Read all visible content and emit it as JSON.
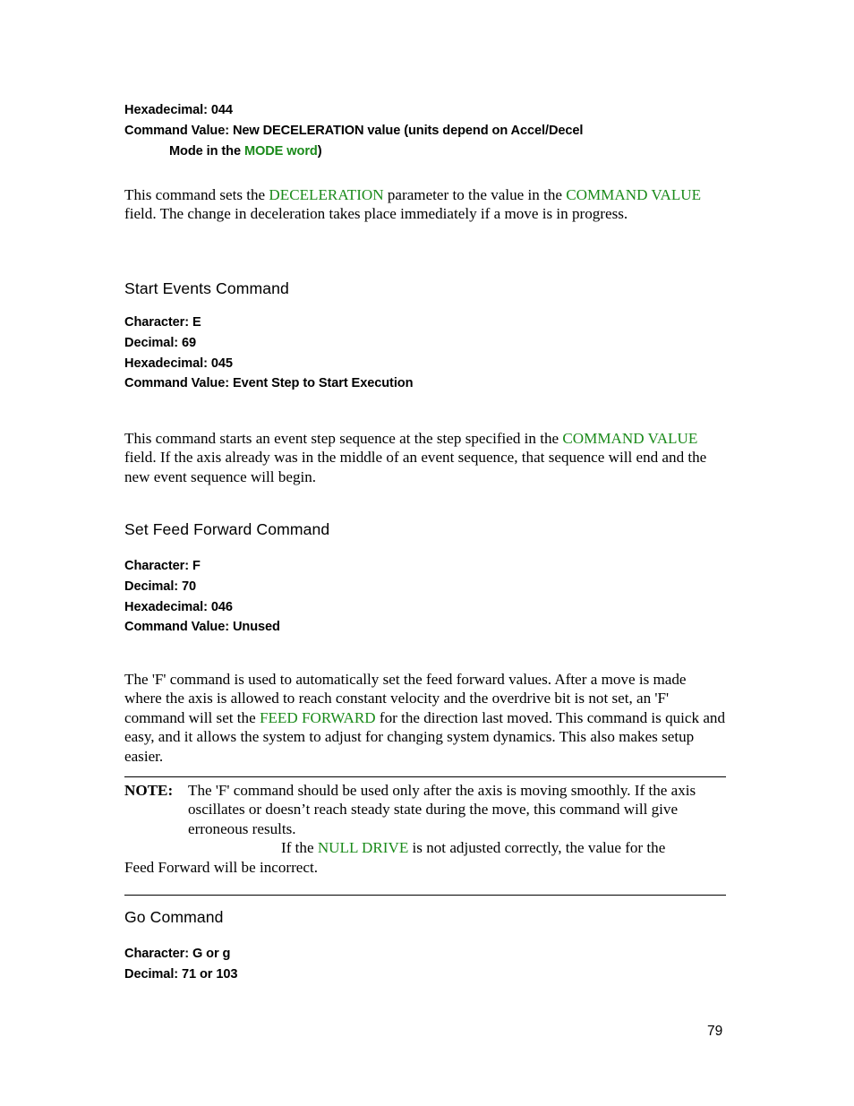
{
  "document": {
    "page_number": "79",
    "accent_green": "#1a8a1a"
  },
  "decel_section": {
    "hexadecimal_line": "Hexadecimal: 044",
    "command_value_line": "Command Value: New DECELERATION value (units depend on Accel/Decel",
    "command_value_cont_pre": "Mode in the ",
    "command_value_cont_green": "MODE word",
    "command_value_cont_post": ")",
    "paragraph": {
      "p1": "This command sets the ",
      "g1": "DECELERATION",
      "p2": " parameter to the value in the ",
      "g2": "COMMAND VALUE",
      "p3": " field.  The change in deceleration takes place immediately if a move is in progress."
    }
  },
  "start_events_section": {
    "heading": "Start Events Command",
    "attributes": [
      "Character: E",
      "Decimal: 69",
      "Hexadecimal: 045",
      "Command Value: Event Step to Start Execution"
    ],
    "paragraph": {
      "p1": "This command starts an event step sequence at the step specified in the ",
      "g1": "COMMAND VALUE",
      "p2": " field.  If the axis already was in the middle of an event sequence, that sequence will end and the new event sequence will begin."
    }
  },
  "feed_forward_section": {
    "heading": "Set Feed Forward Command",
    "attributes": [
      "Character: F",
      "Decimal: 70",
      "Hexadecimal: 046",
      "Command Value: Unused"
    ],
    "paragraph": {
      "p1": "The 'F' command is used to automatically set the feed forward values.  After a move is made where the axis is allowed to reach constant velocity and the overdrive bit is not set, an 'F' command will set the ",
      "g1": "FEED FORWARD",
      "p2": " for the direction last moved.  This command is quick and easy, and it allows the system to adjust for changing system dynamics.  This also makes setup easier."
    },
    "note": {
      "label": "NOTE:",
      "t1": "The 'F' command should be used only after the axis is moving smoothly.  If the axis oscillates or doesn’t reach steady state during the move, this command will give erroneous results.",
      "t2_pre": "If the ",
      "t2_green": "NULL DRIVE",
      "t2_post": " is not adjusted correctly, the value for the",
      "t3": "Feed Forward will be incorrect."
    }
  },
  "go_section": {
    "heading": "Go Command",
    "attributes": [
      "Character: G or g",
      "Decimal: 71 or 103"
    ]
  }
}
